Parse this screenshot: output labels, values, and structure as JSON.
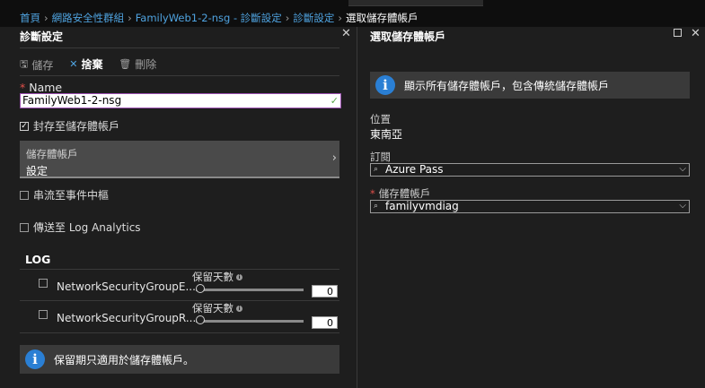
{
  "breadcrumb": {
    "items": [
      "首頁",
      "網路安全性群組",
      "FamilyWeb1-2-nsg - 診斷設定",
      "診斷設定",
      "選取儲存體帳戶"
    ]
  },
  "left_blade": {
    "title": "診斷設定",
    "close_glyph": "✕",
    "toolbar": {
      "save": {
        "icon": "save-icon",
        "glyph": "🖫",
        "label": "儲存"
      },
      "discard": {
        "icon": "close-icon",
        "glyph": "✕",
        "label": "捨棄"
      },
      "delete": {
        "icon": "trash-icon",
        "glyph": "🗑",
        "label": "刪除"
      }
    },
    "name_field": {
      "required_mark": "*",
      "label": "Name",
      "value": "FamilyWeb1-2-nsg",
      "valid_glyph": "✓"
    },
    "archive_checkbox": {
      "label": "封存至儲存體帳戶",
      "checked": true,
      "glyph": "✓"
    },
    "storage_account": {
      "label": "儲存體帳戶",
      "value": "設定",
      "chevron": "›"
    },
    "event_hub_checkbox": {
      "label": "串流至事件中樞",
      "checked": false
    },
    "log_analytics_checkbox": {
      "label": "傳送至 Log Analytics",
      "checked": false
    },
    "log_section": {
      "title": "LOG",
      "rows": [
        {
          "name": "NetworkSecurityGroupE...",
          "retention_label": "保留天數",
          "retention_days": "0",
          "checked": false
        },
        {
          "name": "NetworkSecurityGroupR...",
          "retention_label": "保留天數",
          "retention_days": "0",
          "checked": false
        }
      ]
    },
    "info_banner": {
      "icon": "info-icon",
      "glyph": "i",
      "text": "保留期只適用於儲存體帳戶。"
    }
  },
  "right_blade": {
    "title": "選取儲存體帳戶",
    "close_glyph": "✕",
    "info_banner": {
      "icon": "info-icon",
      "glyph": "i",
      "text": "顯示所有儲存體帳戶，包含傳統儲存體帳戶"
    },
    "location": {
      "label": "位置",
      "value": "東南亞"
    },
    "subscription": {
      "label": "訂閱",
      "value": "Azure Pass"
    },
    "storage_account": {
      "required_mark": "*",
      "label": "儲存體帳戶",
      "value": "familyvmdiag"
    },
    "dropdown_glyphs": {
      "search": "⌕",
      "chevron": "⌵"
    }
  },
  "colors": {
    "background": "#1e1e1e",
    "link_blue": "#4fa3e0",
    "info_blue": "#2a7fd4",
    "required_red": "#e0504a",
    "valid_green": "#57a64a"
  }
}
